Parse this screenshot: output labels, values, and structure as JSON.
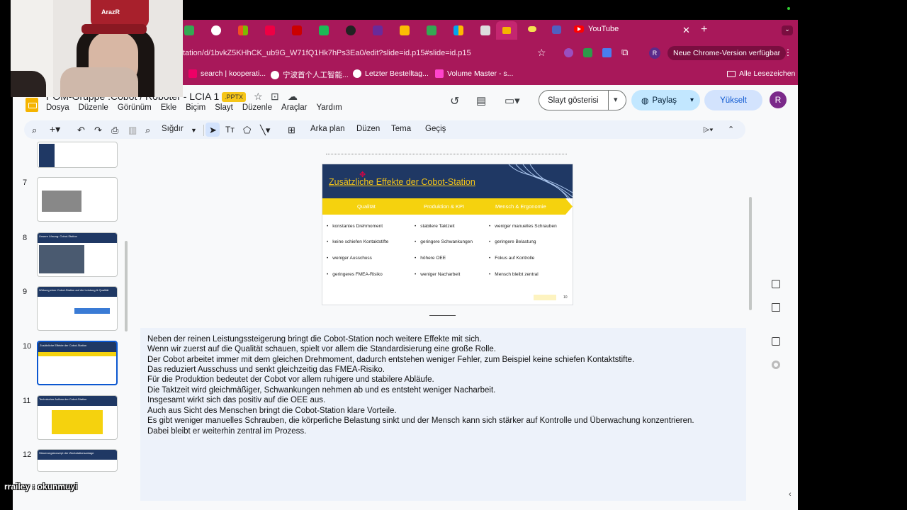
{
  "browser": {
    "url": "tation/d/1bvkZ5KHhCK_ub9G_W71fQ1Hk7hPs3Ea0/edit?slide=id.p15#slide=id.p15",
    "youtube_tab": "YouTube",
    "update_label": "Neue Chrome-Version verfügbar",
    "profile_initial": "R",
    "bookmarks": [
      "search | kooperati...",
      "宁波首个人工智能...",
      "Letzter Bestelltag...",
      "Volume Master - s..."
    ],
    "all_bookmarks": "Alle Lesezeichen"
  },
  "app": {
    "title": "POM-Gruppe :Cobot / Roboter - LCIA 1",
    "badge": ".PPTX",
    "menu": [
      "Dosya",
      "Düzenle",
      "Görünüm",
      "Ekle",
      "Biçim",
      "Slayt",
      "Düzenle",
      "Araçlar",
      "Yardım"
    ],
    "slideshow_label": "Slayt gösterisi",
    "share_label": "Paylaş",
    "upgrade_label": "Yükselt",
    "avatar_initial": "R"
  },
  "toolbar": {
    "zoom_label": "Sığdır",
    "background": "Arka plan",
    "layout": "Düzen",
    "theme": "Tema",
    "transition": "Geçiş"
  },
  "filmstrip": [
    {
      "num": "",
      "title": ""
    },
    {
      "num": "7",
      "title": ""
    },
    {
      "num": "8",
      "title": "Unsere Lösung: Cobot-Station"
    },
    {
      "num": "9",
      "title": "Wirkung einer Cobot-Station auf die Leistung & Qualität"
    },
    {
      "num": "10",
      "title": "Zusätzliche Effekte der Cobot-Station"
    },
    {
      "num": "11",
      "title": "Technischer Aufbau der Cobot-Station"
    },
    {
      "num": "12",
      "title": "Steuerungskonzept der Workstationsanlage"
    }
  ],
  "slide": {
    "title": "Zusätzliche Effekte der Cobot-Station",
    "columns": [
      {
        "header": "Qualität",
        "items": [
          "konstantes Drehmoment",
          "keine schiefen Kontaktstifte",
          "weniger Ausschuss",
          "geringeres FMEA-Risiko"
        ]
      },
      {
        "header": "Produktion & KPI",
        "items": [
          "stabilere Taktzeit",
          "geringere Schwankungen",
          "höhere OEE",
          "weniger Nacharbeit"
        ]
      },
      {
        "header": "Mensch & Ergonomie",
        "items": [
          "weniger manuelles Schrauben",
          "geringere Belastung",
          "Fokus auf Kontrolle",
          "Mensch bleibt zentral"
        ]
      }
    ],
    "page_number": "10"
  },
  "notes": [
    "Neben der reinen Leistungssteigerung bringt die Cobot-Station noch weitere Effekte mit sich.",
    "Wenn wir zuerst auf die Qualität schauen, spielt vor allem die Standardisierung eine große Rolle.",
    "Der Cobot arbeitet immer mit dem gleichen Drehmoment, dadurch entstehen weniger Fehler, zum Beispiel keine schiefen Kontaktstifte.",
    "Das reduziert Ausschuss und senkt gleichzeitig das FMEA-Risiko.",
    "Für die Produktion bedeutet der Cobot vor allem ruhigere und stabilere Abläufe.",
    "Die Taktzeit wird gleichmäßiger, Schwankungen nehmen ab und es entsteht weniger Nacharbeit.",
    "Insgesamt wirkt sich das positiv auf die OEE aus.",
    " Auch aus Sicht des Menschen bringt die Cobot-Station klare Vorteile.",
    "Es gibt weniger manuelles Schrauben, die körperliche Belastung sinkt und der Mensch kann sich stärker auf Kontrolle und Überwachung konzentrieren.",
    "Dabei bleibt er weiterhin zentral im Prozess."
  ],
  "overlay": {
    "chat_text": "rrailey : okunmuyi",
    "cap_text": "ArazR"
  }
}
